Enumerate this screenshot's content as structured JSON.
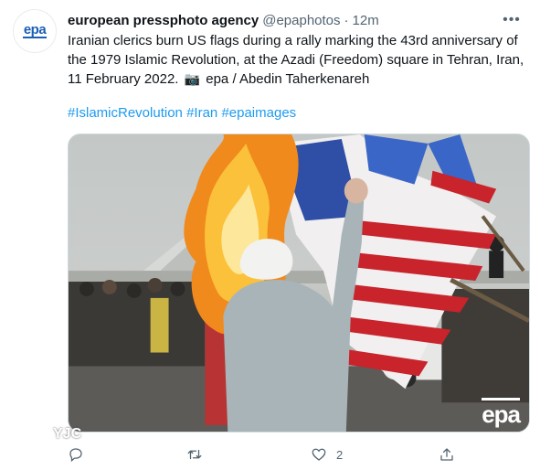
{
  "tweet": {
    "avatar_text": "epa",
    "name": "european pressphoto agency",
    "handle": "@epaphotos",
    "separator": "·",
    "time": "12m",
    "more_icon": "more-icon",
    "text_part1": "Iranian clerics burn US flags during a rally marking the 43rd anniversary of the 1979 Islamic Revolution, at the Azadi (Freedom) square in Tehran, Iran, 11 February 2022.",
    "camera_emoji": "📷",
    "text_part2": "epa / Abedin Taherkenareh",
    "hashtags": [
      "#IslamicRevolution",
      "#Iran",
      "#epaimages"
    ],
    "media": {
      "watermark_epa": "epa",
      "watermark_yjc": "YJC"
    },
    "actions": {
      "reply_icon": "reply-icon",
      "retweet_icon": "retweet-icon",
      "like_icon": "heart-icon",
      "like_count": "2",
      "share_icon": "share-icon"
    }
  },
  "colors": {
    "link": "#1d9bf0",
    "text": "#0f1419",
    "muted": "#536471"
  }
}
